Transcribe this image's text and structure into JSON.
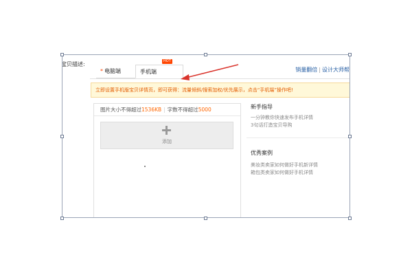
{
  "field_label": "宝贝描述:",
  "tabs": {
    "pc": {
      "required_mark": "*",
      "label": "电脑端"
    },
    "mobile": {
      "label": "手机端",
      "badge": "HOT"
    }
  },
  "top_links": {
    "link1": "销量翻倍",
    "sep": "|",
    "link2": "设计大师帮"
  },
  "notice": "立即设置手机版宝贝详情页，即可获得：流量倾斜/搜索加权/优先展示，点击“手机端”操作吧!",
  "editor": {
    "size_label": "图片大小不得超过",
    "size_limit": "1536KB",
    "divider": "|",
    "chars_label": "字数不得超过",
    "chars_limit": "5000",
    "add_label": "添加"
  },
  "sidebar": {
    "guide_title": "新手指导",
    "guide_items": [
      "一分钟教你快速发布手机详情",
      "3句话打造宝贝导购"
    ],
    "cases_title": "优秀案例",
    "case_items": [
      "美妆类卖家如何做好手机新详情",
      "箱包类卖家如何做好手机详情"
    ]
  },
  "colors": {
    "accent": "#ff4400",
    "link": "#2b62a6",
    "notice_bg": "#fff8d9",
    "arrow": "#d9332b"
  }
}
